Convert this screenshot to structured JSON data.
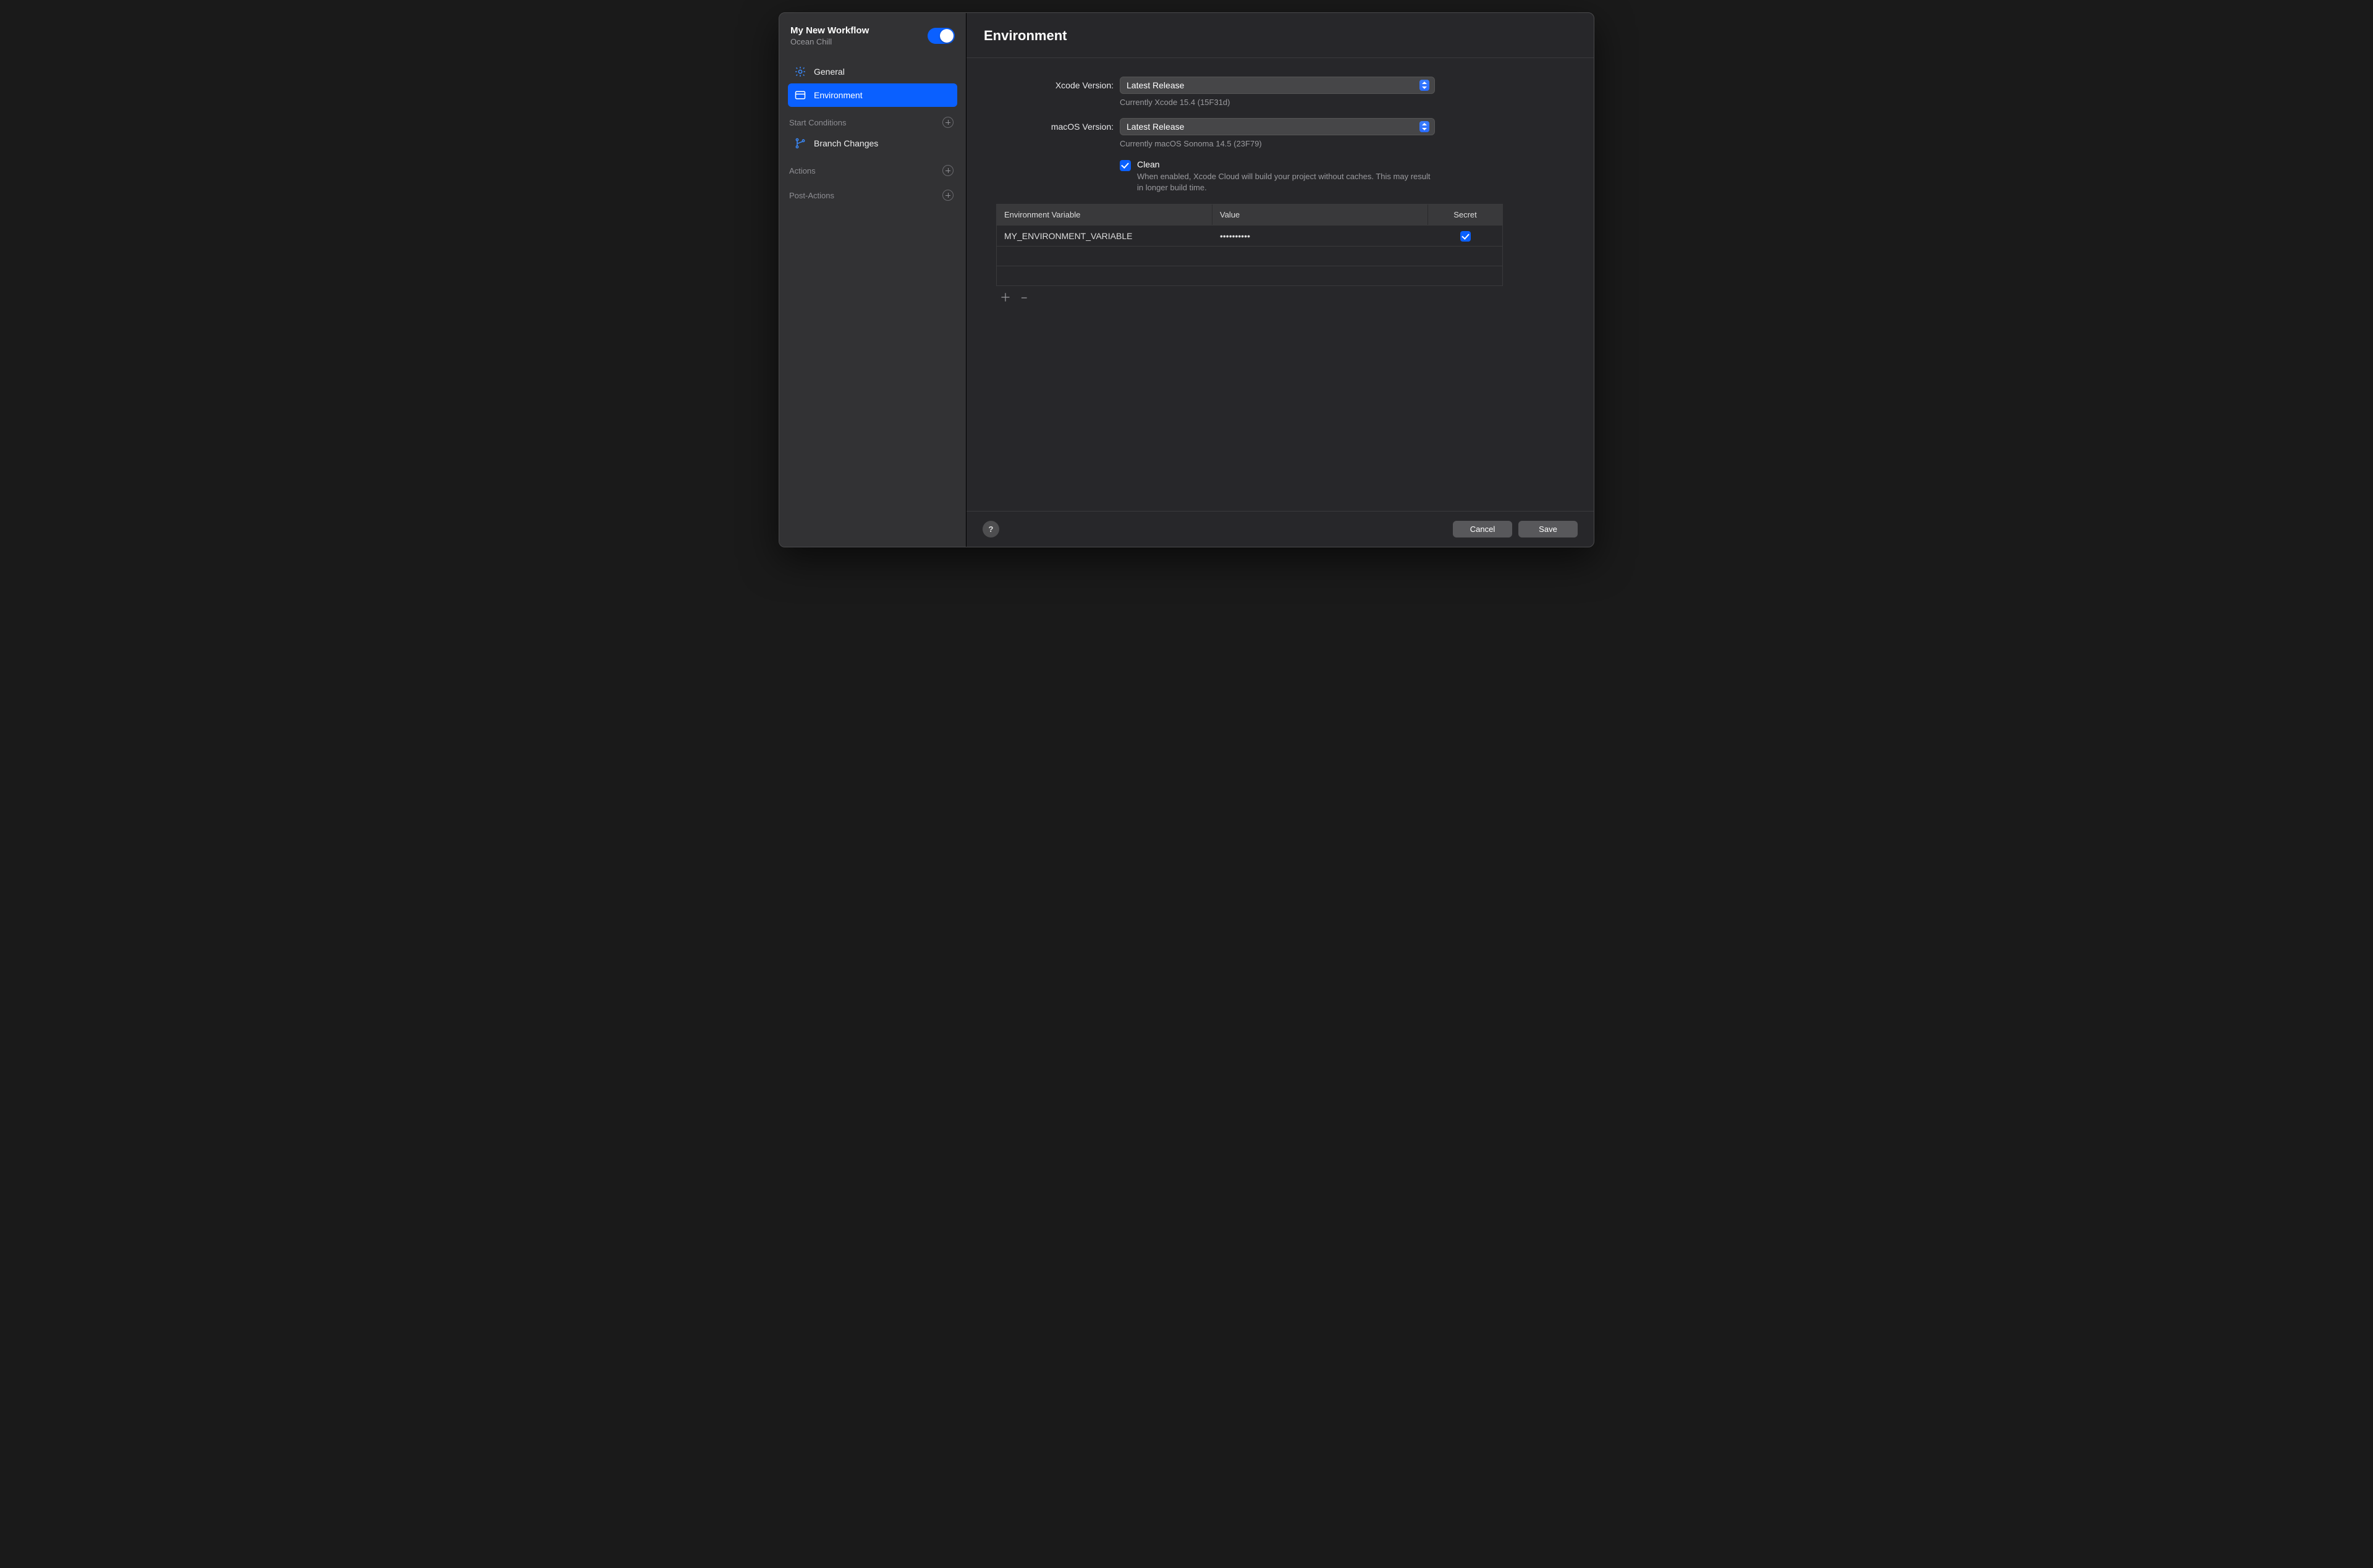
{
  "sidebar": {
    "title": "My New Workflow",
    "subtitle": "Ocean Chill",
    "items": {
      "general": "General",
      "environment": "Environment",
      "branch_changes": "Branch Changes"
    },
    "groups": {
      "start_conditions": "Start Conditions",
      "actions": "Actions",
      "post_actions": "Post-Actions"
    }
  },
  "main": {
    "title": "Environment",
    "xcode": {
      "label": "Xcode Version:",
      "value": "Latest Release",
      "current": "Currently Xcode 15.4 (15F31d)"
    },
    "macos": {
      "label": "macOS Version:",
      "value": "Latest Release",
      "current": "Currently macOS Sonoma 14.5 (23F79)"
    },
    "clean": {
      "label": "Clean",
      "desc": "When enabled, Xcode Cloud will build your project without caches. This may result in longer build time."
    },
    "env_table": {
      "col_var": "Environment Variable",
      "col_val": "Value",
      "col_secret": "Secret",
      "rows": [
        {
          "name": "MY_ENVIRONMENT_VARIABLE",
          "value": "••••••••••",
          "secret": true
        }
      ]
    }
  },
  "footer": {
    "cancel": "Cancel",
    "save": "Save"
  }
}
